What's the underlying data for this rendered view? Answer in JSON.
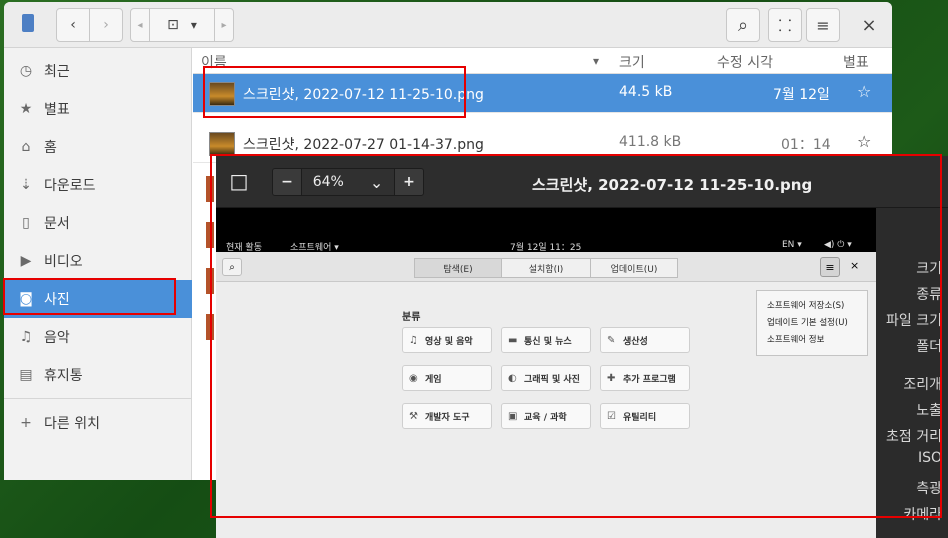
{
  "header": {
    "back": "‹",
    "forward": "›",
    "prev": "◂",
    "next": "▸",
    "location": "⊡",
    "dropdown": "▾",
    "search_icon": "⌕",
    "view_icon": "⸬",
    "menu_icon": "≡",
    "close_icon": "×"
  },
  "sidebar": {
    "items": [
      {
        "icon": "◷",
        "label": "최근"
      },
      {
        "icon": "★",
        "label": "별표"
      },
      {
        "icon": "⌂",
        "label": "홈"
      },
      {
        "icon": "⇣",
        "label": "다운로드"
      },
      {
        "icon": "▯",
        "label": "문서"
      },
      {
        "icon": "▶",
        "label": "비디오"
      },
      {
        "icon": "◙",
        "label": "사진"
      },
      {
        "icon": "♫",
        "label": "음악"
      },
      {
        "icon": "▤",
        "label": "휴지통"
      },
      {
        "icon": "+",
        "label": "다른 위치"
      }
    ]
  },
  "columns": {
    "name": "이름",
    "size": "크기",
    "modified": "수정 시각",
    "star": "별표",
    "sort_arrow": "▾"
  },
  "files": [
    {
      "name": "스크린샷, 2022-07-12 11-25-10.png",
      "size": "44.5 kB",
      "modified": "7월 12일",
      "star": "☆"
    },
    {
      "name": "스크린샷, 2022-07-27 01-14-37.png",
      "size": "411.8 kB",
      "modified": "01：14",
      "star": "☆"
    }
  ],
  "viewer": {
    "title": "스크린샷, 2022-07-12 11-25-10.png",
    "zoom": "64%",
    "zoom_out": "−",
    "zoom_in": "+",
    "zoom_menu": "⌄",
    "fit": "□",
    "properties": [
      "크기",
      "종류",
      "파일 크기",
      "폴더",
      "조리개",
      "노출",
      "초점 거리",
      "ISO",
      "측광",
      "카메라"
    ]
  },
  "screenshot": {
    "topbar": {
      "activities": "현재 활동",
      "app_menu": "소프트웨어 ▾",
      "clock": "7월 12일 11：25",
      "lang": "EN ▾",
      "status": "◀) ⏻ ▾"
    },
    "tabs": [
      "탐색(E)",
      "설치함(I)",
      "업데이트(U)"
    ],
    "search_icon": "⌕",
    "menu_icon": "≡",
    "close_icon": "×",
    "section_title": "분류",
    "categories": [
      {
        "icon": "♫",
        "label": "영상 및 음악"
      },
      {
        "icon": "▬",
        "label": "통신 및 뉴스"
      },
      {
        "icon": "✎",
        "label": "생산성"
      },
      {
        "icon": "◉",
        "label": "게임"
      },
      {
        "icon": "◐",
        "label": "그래픽 및 사진"
      },
      {
        "icon": "✚",
        "label": "추가 프로그램"
      },
      {
        "icon": "⚒",
        "label": "개발자 도구"
      },
      {
        "icon": "▣",
        "label": "교육 / 과학"
      },
      {
        "icon": "☑",
        "label": "유틸리티"
      }
    ],
    "menu_items": [
      "소프트웨어 저장소(S)",
      "업데이트 기본 설정(U)",
      "소프트웨어 정보"
    ]
  }
}
